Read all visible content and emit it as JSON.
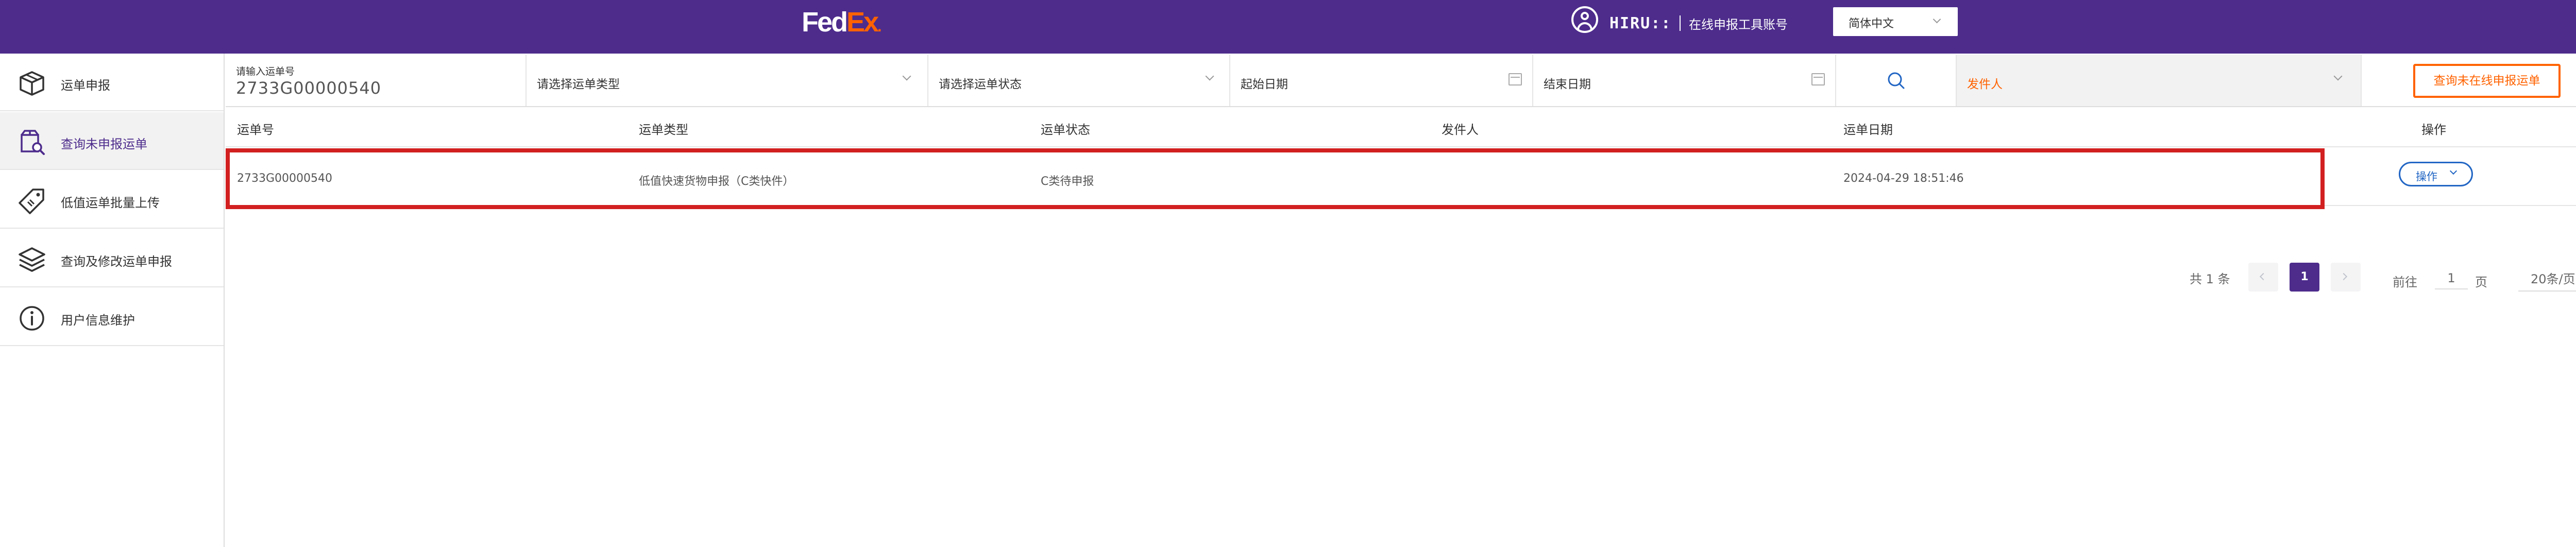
{
  "header": {
    "logo_fed": "Fed",
    "logo_ex": "Ex",
    "logo_dot": ".",
    "user_name": "HIRU::",
    "account_label": "在线申报工具账号",
    "language": "简体中文"
  },
  "sidebar": {
    "items": [
      {
        "label": "运单申报",
        "icon": "box-icon"
      },
      {
        "label": "查询未申报运单",
        "icon": "package-search-icon"
      },
      {
        "label": "低值运单批量上传",
        "icon": "tag-icon"
      },
      {
        "label": "查询及修改运单申报",
        "icon": "layers-icon"
      },
      {
        "label": "用户信息维护",
        "icon": "info-icon"
      }
    ]
  },
  "filters": {
    "waybill_label": "请输入运单号",
    "waybill_value": "2733G00000540",
    "type_placeholder": "请选择运单类型",
    "status_placeholder": "请选择运单状态",
    "start_date_placeholder": "起始日期",
    "end_date_placeholder": "结束日期",
    "sender_placeholder": "发件人",
    "query_button": "查询未在线申报运单"
  },
  "table": {
    "columns": [
      "运单号",
      "运单类型",
      "运单状态",
      "发件人",
      "运单日期",
      "操作"
    ],
    "rows": [
      {
        "waybill_no": "2733G00000540",
        "type": "低值快速货物申报（C类快件）",
        "status": "C类待申报",
        "sender": "",
        "date": "2024-04-29 18:51:46",
        "action": "操作"
      }
    ]
  },
  "pagination": {
    "total": "共 1 条",
    "current_page": "1",
    "goto_prefix": "前往",
    "goto_value": "1",
    "goto_suffix": "页",
    "page_size": "20条/页"
  },
  "colors": {
    "brand_purple": "#4d2c8c",
    "brand_orange": "#ff6200",
    "highlight_red": "#d22020",
    "link_blue": "#2266c4"
  }
}
